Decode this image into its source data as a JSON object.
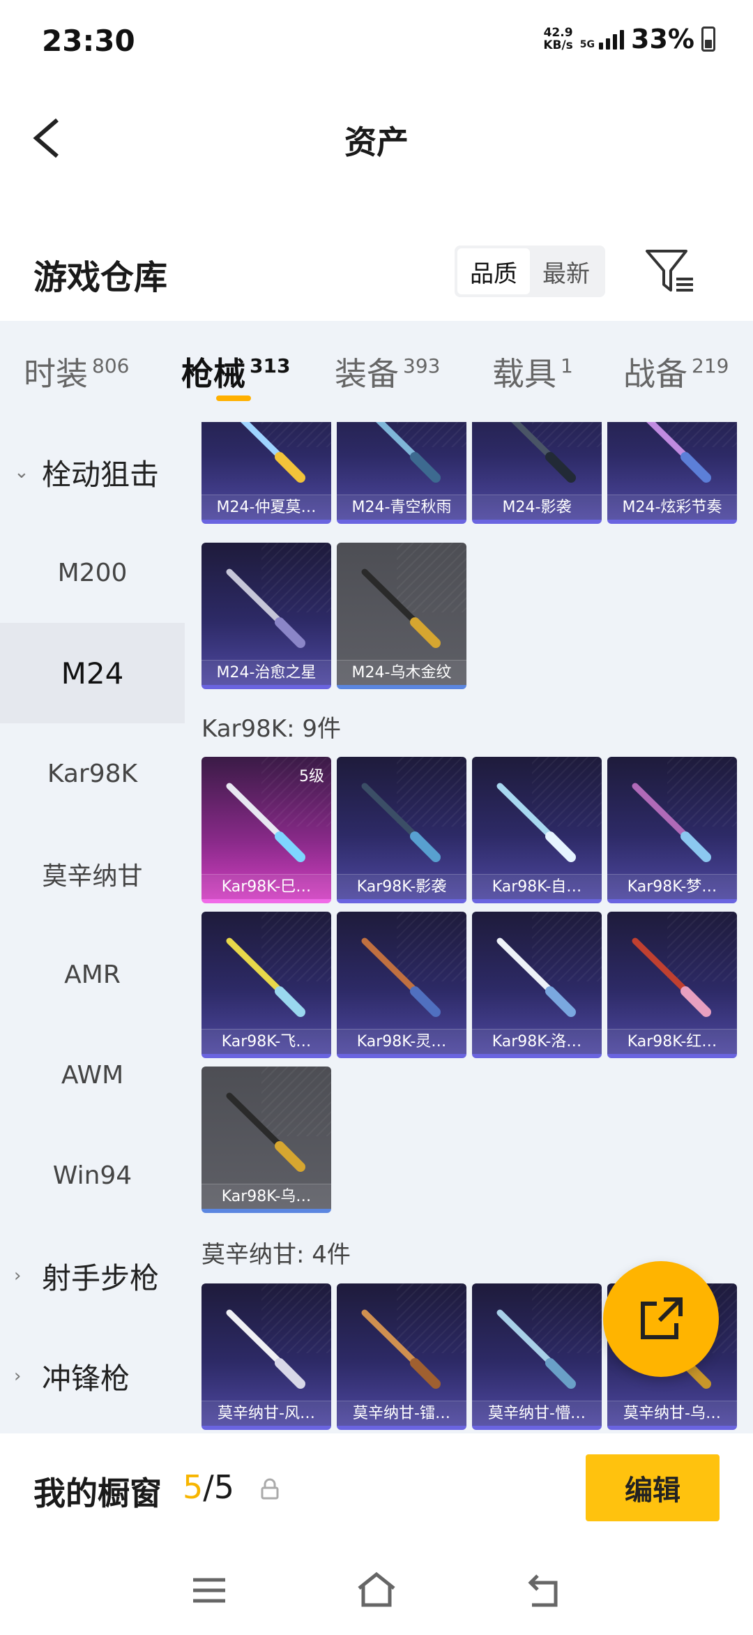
{
  "status_bar": {
    "time": "23:30",
    "net_speed_value": "42.9",
    "net_speed_unit": "KB/s",
    "network": "5G",
    "battery": "33%"
  },
  "header": {
    "title": "资产"
  },
  "warehouse": {
    "title": "游戏仓库",
    "sort_options": [
      "品质",
      "最新"
    ],
    "active_sort": "品质"
  },
  "tabs": [
    {
      "label": "时装",
      "count": "806"
    },
    {
      "label": "枪械",
      "count": "313",
      "active": true
    },
    {
      "label": "装备",
      "count": "393"
    },
    {
      "label": "载具",
      "count": "1"
    },
    {
      "label": "战备",
      "count": "219"
    }
  ],
  "sidebar": {
    "group_expanded": "栓动狙击",
    "items": [
      "M200",
      "M24",
      "Kar98K",
      "莫辛纳甘",
      "AMR",
      "AWM",
      "Win94"
    ],
    "active_item": "M24",
    "groups_collapsed": [
      "射手步枪",
      "冲锋枪"
    ]
  },
  "content": {
    "m24_items": [
      {
        "label": "M24-仲夏莫…",
        "tier": "purple"
      },
      {
        "label": "M24-青空秋雨",
        "tier": "purple"
      },
      {
        "label": "M24-影袭",
        "tier": "purple"
      },
      {
        "label": "M24-炫彩节奏",
        "tier": "purple"
      },
      {
        "label": "M24-治愈之星",
        "tier": "purple"
      },
      {
        "label": "M24-乌木金纹",
        "tier": "gray"
      }
    ],
    "kar98k_section": "Kar98K: 9件",
    "kar98k_items": [
      {
        "label": "Kar98K-巳…",
        "tier": "pink",
        "badge": "5级"
      },
      {
        "label": "Kar98K-影袭",
        "tier": "purple"
      },
      {
        "label": "Kar98K-自…",
        "tier": "purple"
      },
      {
        "label": "Kar98K-梦…",
        "tier": "purple"
      },
      {
        "label": "Kar98K-飞…",
        "tier": "purple"
      },
      {
        "label": "Kar98K-灵…",
        "tier": "purple"
      },
      {
        "label": "Kar98K-洛…",
        "tier": "purple"
      },
      {
        "label": "Kar98K-红…",
        "tier": "purple"
      },
      {
        "label": "Kar98K-乌…",
        "tier": "gray"
      }
    ],
    "mosin_section": "莫辛纳甘: 4件",
    "mosin_items": [
      {
        "label": "莫辛纳甘-风…",
        "tier": "purple"
      },
      {
        "label": "莫辛纳甘-镭…",
        "tier": "purple"
      },
      {
        "label": "莫辛纳甘-懵…",
        "tier": "purple"
      },
      {
        "label": "莫辛纳甘-乌…",
        "tier": "purple"
      }
    ]
  },
  "showcase": {
    "title": "我的橱窗",
    "current": "5",
    "separator": "/",
    "max": "5",
    "edit_label": "编辑"
  },
  "colors": {
    "accent": "#ffb400",
    "card_purple": "#2d2a66",
    "card_gray": "#5e5f66",
    "card_pink": "#d040c0"
  },
  "icons": {
    "back": "back-arrow-icon",
    "filter": "filter-icon",
    "share": "share-icon",
    "lock": "lock-icon",
    "nav": [
      "menu-icon",
      "home-icon",
      "back-icon"
    ]
  }
}
